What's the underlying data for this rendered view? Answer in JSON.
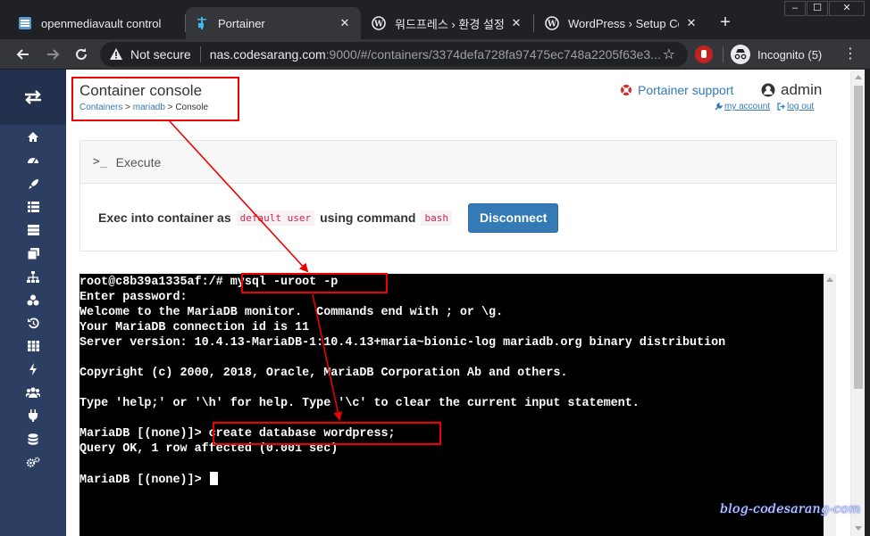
{
  "browser": {
    "tabs": [
      {
        "title": "openmediavault control",
        "icon": "omv-icon",
        "active": false
      },
      {
        "title": "Portainer",
        "icon": "portainer-icon",
        "active": true
      },
      {
        "title": "워드프레스 › 환경 설정 ›",
        "icon": "wordpress-icon",
        "active": false
      },
      {
        "title": "WordPress › Setup Confi",
        "icon": "wordpress-icon",
        "active": false
      }
    ],
    "window_controls": [
      "–",
      "☐",
      "✕"
    ],
    "address": {
      "security_label": "Not secure",
      "host": "nas.codesarang.com",
      "path": ":9000/#/containers/3374defa728fa97475ec748a2205f63e3..."
    },
    "profile_label": "Incognito (5)"
  },
  "header": {
    "title": "Container console",
    "breadcrumbs": {
      "containers": "Containers",
      "sep1": " > ",
      "container": "mariadb",
      "sep2": " > ",
      "current": "Console"
    },
    "support_label": "Portainer support",
    "username": "admin",
    "my_account": "my account",
    "log_out": "log out"
  },
  "sidebar": {
    "items": [
      "home-icon",
      "dashboard-icon",
      "app-templates-icon",
      "stacks-icon",
      "containers-icon",
      "images-icon",
      "networks-icon",
      "volumes-icon",
      "events-icon",
      "host-icon",
      "extensions-icon",
      "users-icon",
      "endpoints-icon",
      "registries-icon",
      "settings-icon"
    ],
    "selected_index": 4
  },
  "exec": {
    "panel_title": "Execute",
    "text_prefix": "Exec into container as",
    "user_code": "default user",
    "text_mid": "using command",
    "command_code": "bash",
    "disconnect_label": "Disconnect"
  },
  "terminal": {
    "lines": [
      "root@c8b39a1335af:/# mysql -uroot -p",
      "Enter password:",
      "Welcome to the MariaDB monitor.  Commands end with ; or \\g.",
      "Your MariaDB connection id is 11",
      "Server version: 10.4.13-MariaDB-1:10.4.13+maria~bionic-log mariadb.org binary distribution",
      "",
      "Copyright (c) 2000, 2018, Oracle, MariaDB Corporation Ab and others.",
      "",
      "Type 'help;' or '\\h' for help. Type '\\c' to clear the current input statement.",
      "",
      "MariaDB [(none)]> create database wordpress;",
      "Query OK, 1 row affected (0.001 sec)",
      "",
      "MariaDB [(none)]> "
    ]
  },
  "watermark": "blog-codesarang-com",
  "colors": {
    "sidebar": "#2d3e63",
    "accent": "#337ab7",
    "annotation": "#ee0000"
  }
}
